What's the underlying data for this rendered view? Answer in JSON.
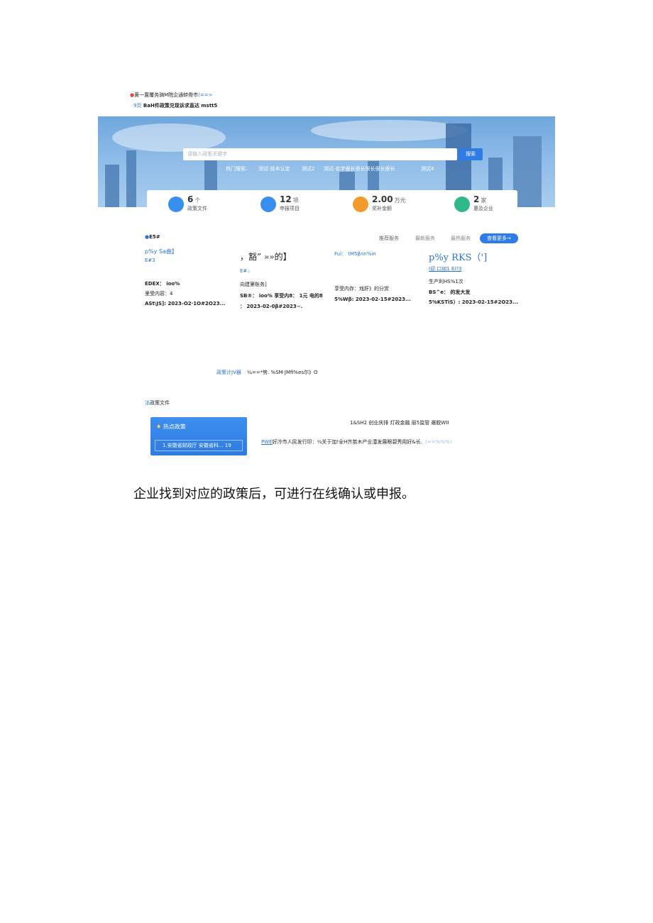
{
  "header": {
    "line1": "黄一置覆务骑M院企通蚌骨市",
    "line1_tail": "(==>",
    "line2_prefix": "9页",
    "line2": "BaH件政策兑现诉求直达 mstt5"
  },
  "hero": {
    "search_placeholder": "请输入政策关键字",
    "search_button": "搜索",
    "hot_label": "热门搜索:",
    "hot_items": [
      "测试-技术认定",
      "测试2",
      "测试-名字很长很长很长很长很长",
      "测试4"
    ]
  },
  "stats": [
    {
      "num": "6",
      "unit": "个",
      "label": "政策文件",
      "color": "#3a8ef0",
      "icon": "document-icon"
    },
    {
      "num": "12",
      "unit": "项",
      "label": "申报项目",
      "color": "#3a8ef0",
      "icon": "chart-icon"
    },
    {
      "num": "2.00",
      "unit": "万元",
      "label": "奖补金额",
      "color": "#f39a2a",
      "icon": "pin-icon"
    },
    {
      "num": "2",
      "unit": "家",
      "label": "惠及企业",
      "color": "#2fb88a",
      "icon": "building-icon"
    }
  ],
  "services": {
    "title": "E5#",
    "tabs": [
      "推荐服务",
      "最新服务",
      "最热服务"
    ],
    "more": "查看更多→",
    "cards": [
      {
        "title": "p%y Sa曲】",
        "sub": "E#3",
        "lines": [
          "EDEX：  ioo%",
          "里受内容：4",
          "ASt\\JS]: 2023-O2·1O#2O23..."
        ]
      },
      {
        "title": "，豁”  »»的】",
        "sub": "E#.:",
        "lines": [
          "向建第账务]",
          "SB®：  ioo% 享受内8：  1元  电的8",
          "：    2023-02-0β#2023~."
        ]
      },
      {
        "title": "Ful：  tM5βnn%in",
        "sub": "",
        "lines": [
          "享受内存：戏肝》的分赏",
          "5%Wβ: 2023-02-15#2023..."
        ]
      },
      {
        "title": "p%y  RKS（']",
        "sub": "I迎  口如1 El?3",
        "lines": [
          "生产利HS%1次",
          "BS^e：  的发大发",
          "5%KSTiS）: 2023-02-15#2O23..."
        ]
      }
    ]
  },
  "policy_calc": {
    "link": "政策计JV器",
    "text": "¼==*势. %SM·JMfi%es尔》O"
  },
  "policy_files": {
    "title": "政策文件",
    "prefix": "法",
    "hot_title": "热点政策",
    "hot_item": "1.安徽省财政厅 安徽省科... 19",
    "categories": "1&SH2 创业庆排  灯政金融  丽5监管  邂脱WII",
    "notice_prefix": "PWE",
    "notice": "好冷市人民发行印：¼关于加!全H齐苗木产业澧发展眼碧秀用好&长.",
    "notice_tail": "(==%%%)"
  },
  "caption": "企业找到对应的政策后，可进行在线确认或申报。"
}
